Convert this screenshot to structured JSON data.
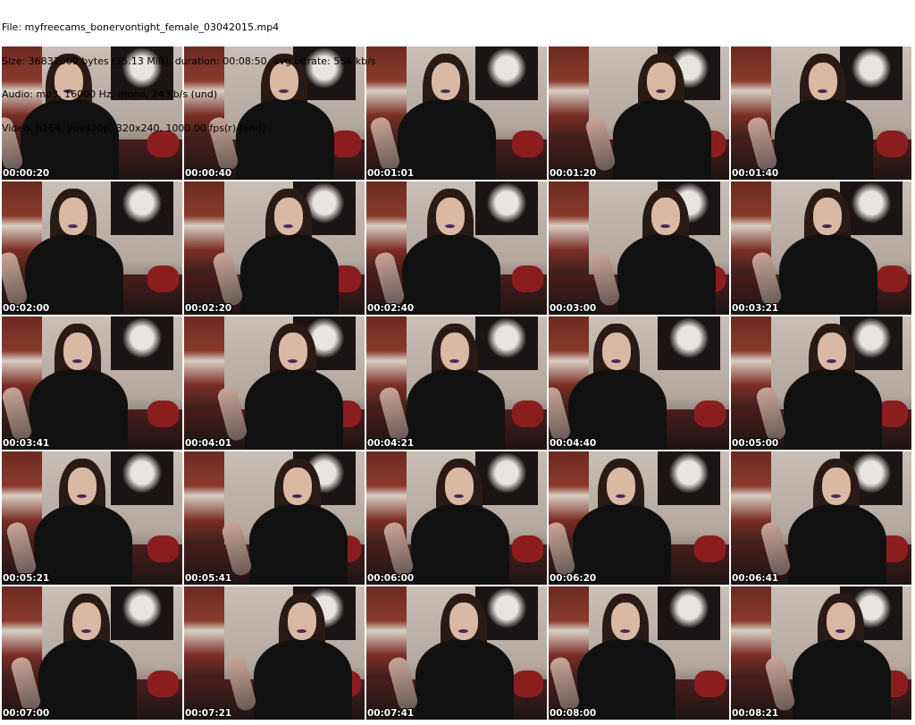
{
  "header": {
    "file": "File: myfreecams_bonervontight_female_03042015.mp4",
    "size": "Size: 36832009 bytes (35.13 MiB), duration: 00:08:50, avg.bitrate: 556 kb/s",
    "audio": "Audio: mp3, 16000 Hz, mono, 24 kb/s (und)",
    "video": "Video: h264, yuv420p, 320x240, 1000.00 fps(r) (und)"
  },
  "thumbnails": [
    "00:00:20",
    "00:00:40",
    "00:01:01",
    "00:01:20",
    "00:01:40",
    "00:02:00",
    "00:02:20",
    "00:02:40",
    "00:03:00",
    "00:03:21",
    "00:03:41",
    "00:04:01",
    "00:04:21",
    "00:04:40",
    "00:05:00",
    "00:05:21",
    "00:05:41",
    "00:06:00",
    "00:06:20",
    "00:06:41",
    "00:07:00",
    "00:07:21",
    "00:07:41",
    "00:08:00",
    "00:08:21"
  ]
}
